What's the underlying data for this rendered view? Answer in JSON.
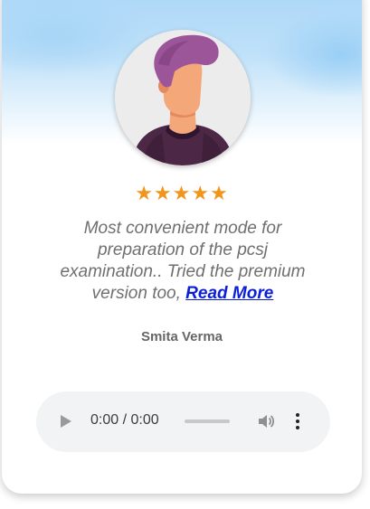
{
  "testimonial": {
    "rating": 5,
    "stars": "★★★★★",
    "quote_text": "Most convenient mode for preparation of the pcsj examination.. Tried the premium version too, ",
    "read_more": "Read More",
    "author": "Smita Verma"
  },
  "audio_player": {
    "time_display": "0:00 / 0:00",
    "progress": 0,
    "icons": [
      "play-icon",
      "volume-icon",
      "more-options-icon"
    ]
  },
  "colors": {
    "star": "#f2961b",
    "quote_text": "#6f6f6f",
    "link": "#0c1fd8",
    "player_bg": "#f1f3f4"
  }
}
